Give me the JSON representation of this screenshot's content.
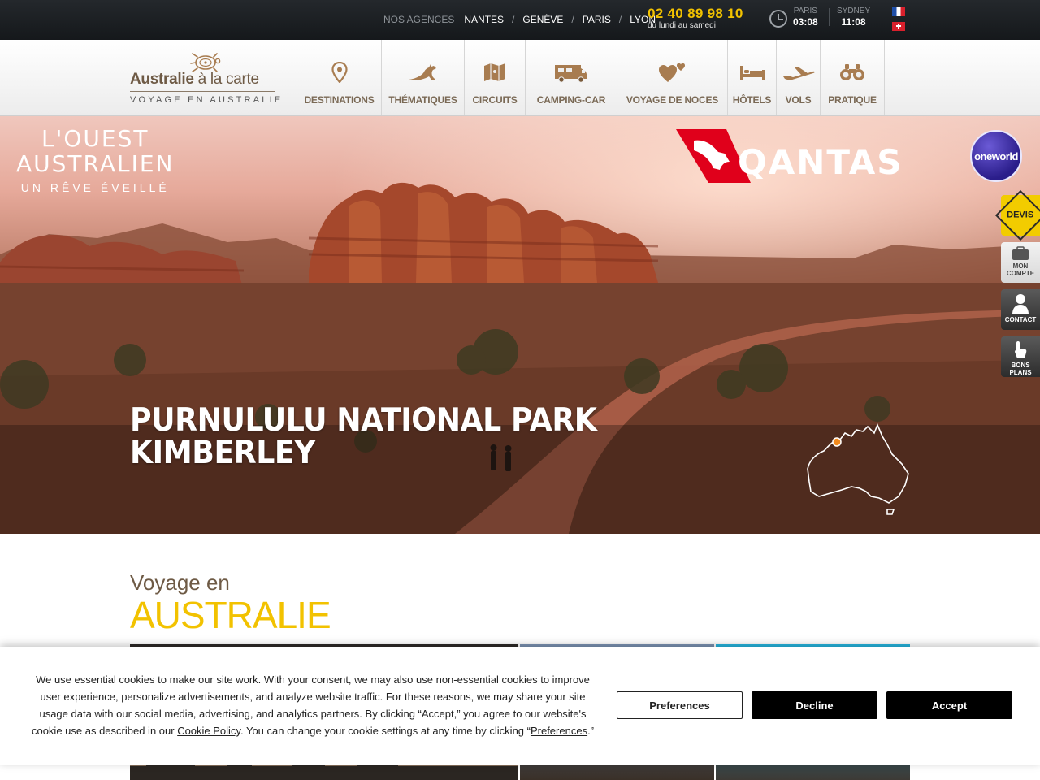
{
  "topbar": {
    "agencies_label": "NOS AGENCES",
    "agencies": [
      "NANTES",
      "GENÈVE",
      "PARIS",
      "LYON"
    ],
    "phone": "02 40 89 98 10",
    "phone_hours": "du lundi au samedi",
    "timezones": [
      {
        "city": "PARIS",
        "time": "03:08"
      },
      {
        "city": "SYDNEY",
        "time": "11:08"
      }
    ],
    "languages": [
      "fr",
      "ch"
    ]
  },
  "logo": {
    "brand_bold": "Australie",
    "brand_rest": " à la carte",
    "tagline": "VOYAGE EN AUSTRALIE"
  },
  "nav": [
    {
      "label": "DESTINATIONS",
      "icon": "map-pin-icon"
    },
    {
      "label": "THÉMATIQUES",
      "icon": "kangaroo-icon"
    },
    {
      "label": "CIRCUITS",
      "icon": "folded-map-icon"
    },
    {
      "label": "CAMPING-CAR",
      "icon": "campervan-icon"
    },
    {
      "label": "VOYAGE DE NOCES",
      "icon": "hearts-icon"
    },
    {
      "label": "HÔTELS",
      "icon": "bed-icon"
    },
    {
      "label": "VOLS",
      "icon": "airplane-icon"
    },
    {
      "label": "PRATIQUE",
      "icon": "binoculars-icon"
    }
  ],
  "hero": {
    "promo_line1": "L'OUEST",
    "promo_line2": "AUSTRALIEN",
    "promo_line3": "UN RÊVE ÉVEILLÉ",
    "airline": "QANTAS",
    "alliance": "oneworld",
    "caption_line1": "PURNULULU NATIONAL PARK",
    "caption_line2": "KIMBERLEY"
  },
  "side_tabs": {
    "devis": "DEVIS",
    "compte": [
      "MON",
      "COMPTE"
    ],
    "contact": "CONTACT",
    "bons_plans": [
      "BONS",
      "PLANS"
    ]
  },
  "section": {
    "title_small": "Voyage en",
    "title_big": "AUSTRALIE"
  },
  "cookie": {
    "text_before_link1": "We use essential cookies to make our site work. With your consent, we may also use non-essential cookies to improve user experience, personalize advertisements, and analyze website traffic. For these reasons, we may share your site usage data with our social media, advertising, and analytics partners. By clicking “Accept,” you agree to our website's cookie use as described in our ",
    "link1": "Cookie Policy",
    "text_between": ". You can change your cookie settings at any time by clicking “",
    "link2": "Preferences",
    "text_after": ".”",
    "btn_preferences": "Preferences",
    "btn_decline": "Decline",
    "btn_accept": "Accept"
  },
  "colors": {
    "accent_yellow": "#f2c200",
    "brand_brown": "#6e5a45",
    "topbar_bg": "#1c1f22"
  }
}
